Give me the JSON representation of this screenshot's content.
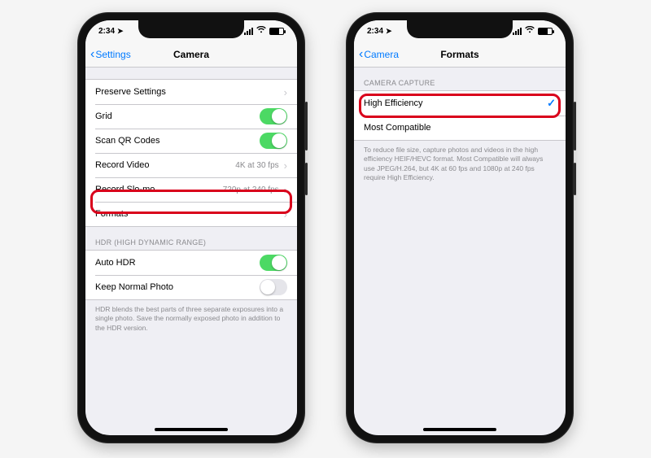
{
  "status": {
    "time": "2:34",
    "loc_icon": "➤"
  },
  "left": {
    "back": "Settings",
    "title": "Camera",
    "rows": {
      "preserve": "Preserve Settings",
      "grid": "Grid",
      "scanqr": "Scan QR Codes",
      "record_video": "Record Video",
      "record_video_val": "4K at 30 fps",
      "record_slomo": "Record Slo-mo",
      "record_slomo_val": "720p at 240 fps",
      "formats": "Formats"
    },
    "hdr_header": "HDR (HIGH DYNAMIC RANGE)",
    "auto_hdr": "Auto HDR",
    "keep_normal": "Keep Normal Photo",
    "hdr_note": "HDR blends the best parts of three separate exposures into a single photo. Save the normally exposed photo in addition to the HDR version."
  },
  "right": {
    "back": "Camera",
    "title": "Formats",
    "section_header": "CAMERA CAPTURE",
    "high_eff": "High Efficiency",
    "most_compat": "Most Compatible",
    "note": "To reduce file size, capture photos and videos in the high efficiency HEIF/HEVC format. Most Compatible will always use JPEG/H.264, but 4K at 60 fps and 1080p at 240 fps require High Efficiency."
  }
}
